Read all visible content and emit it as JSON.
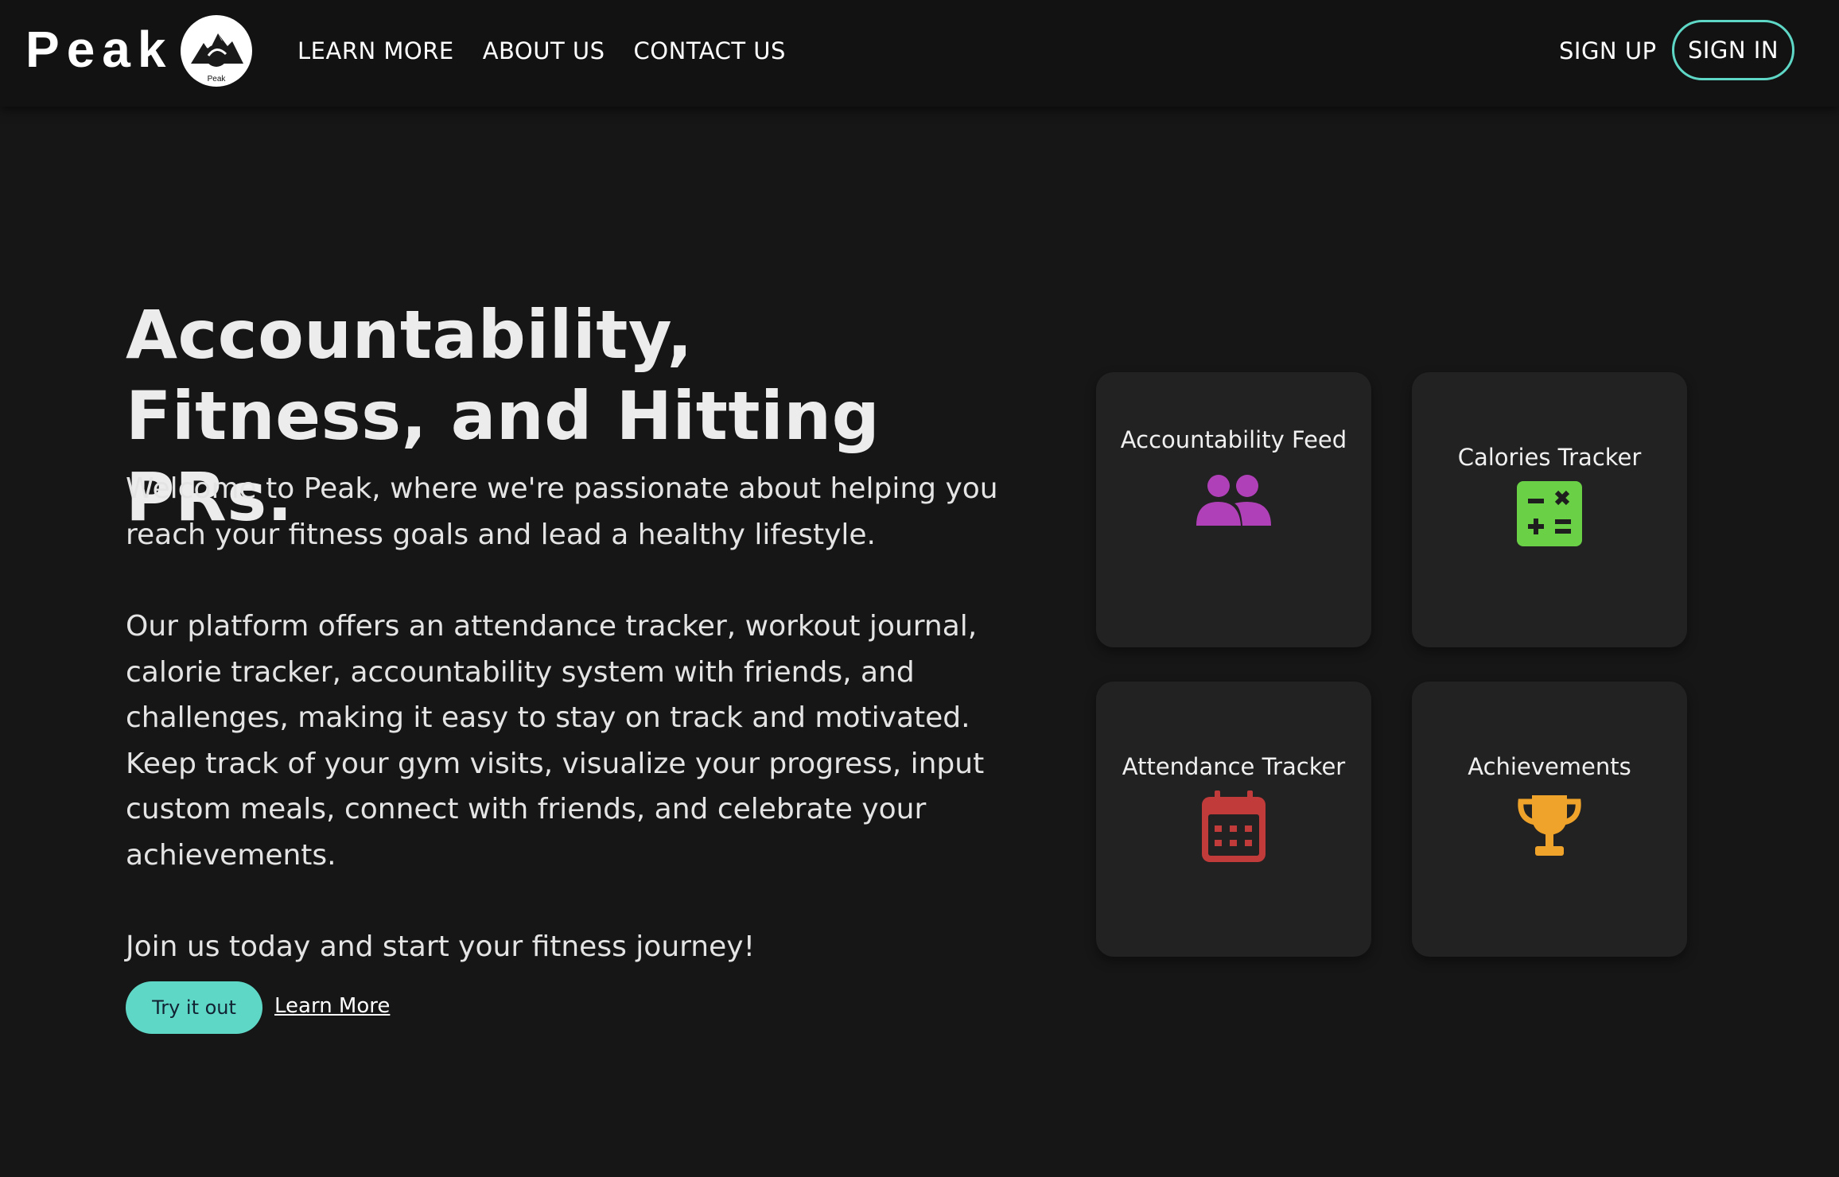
{
  "header": {
    "brand": "Peak",
    "logo_text": "Peak",
    "nav": [
      {
        "label": "LEARN MORE"
      },
      {
        "label": "ABOUT US"
      },
      {
        "label": "CONTACT US"
      }
    ],
    "sign_up": "SIGN UP",
    "sign_in": "SIGN IN",
    "accent_color": "#5fd7c6"
  },
  "hero": {
    "title": "Accountability, Fitness, and Hitting PRs.",
    "paragraph_1": "Welcome to Peak, where we're passionate about helping you reach your fitness goals and lead a healthy lifestyle.",
    "paragraph_2": "Our platform offers an attendance tracker, workout journal, calorie tracker, accountability system with friends, and challenges, making it easy to stay on track and motivated. Keep track of your gym visits, visualize your progress, input custom meals, connect with friends, and celebrate your achievements.",
    "paragraph_3": "Join us today and start your fitness journey!",
    "try_button": "Try it out",
    "learn_more_link": "Learn More"
  },
  "features": [
    {
      "label": "Accountability Feed",
      "icon": "users-icon",
      "color": "#b040b8"
    },
    {
      "label": "Calories Tracker",
      "icon": "calculator-icon",
      "color": "#6ad146"
    },
    {
      "label": "Attendance Tracker",
      "icon": "calendar-icon",
      "color": "#c23b3b"
    },
    {
      "label": "Achievements",
      "icon": "trophy-icon",
      "color": "#f0a32a"
    }
  ]
}
